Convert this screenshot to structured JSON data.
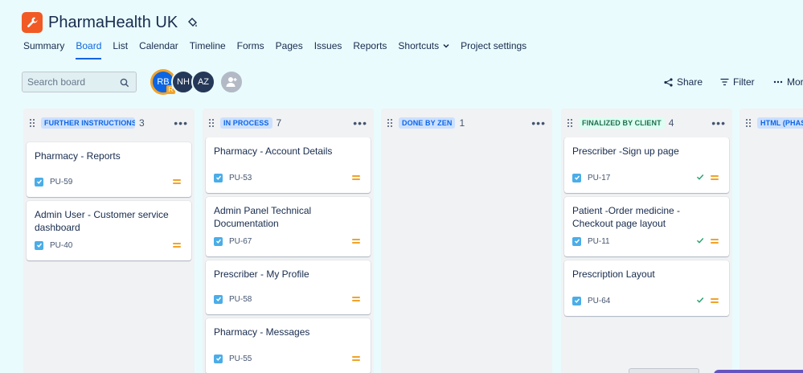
{
  "project": {
    "title": "PharmaHealth UK",
    "logo_icon": "wrench-icon",
    "brand_color": "#f15a24"
  },
  "nav": {
    "tabs": [
      {
        "label": "Summary"
      },
      {
        "label": "Board"
      },
      {
        "label": "List"
      },
      {
        "label": "Calendar"
      },
      {
        "label": "Timeline"
      },
      {
        "label": "Forms"
      },
      {
        "label": "Pages"
      },
      {
        "label": "Issues"
      },
      {
        "label": "Reports"
      },
      {
        "label": "Shortcuts"
      },
      {
        "label": "Project settings"
      }
    ],
    "active": "Board"
  },
  "toolbar": {
    "search_placeholder": "Search board",
    "avatars": [
      {
        "initials": "RB",
        "badge": "R"
      },
      {
        "initials": "NH"
      },
      {
        "initials": "AZ"
      }
    ],
    "share_label": "Share",
    "filter_label": "Filter",
    "more_label": "More"
  },
  "columns": [
    {
      "name": "FURTHER INSTRUCTIONS ...",
      "count": "3",
      "color": "#0c66e4",
      "cards": [
        {
          "title": "Pharmacy - Reports",
          "key": "PU-59",
          "done": false
        },
        {
          "title": "Admin User - Customer service dashboard",
          "key": "PU-40",
          "done": false
        }
      ]
    },
    {
      "name": "IN PROCESS",
      "count": "7",
      "color": "#0c66e4",
      "cards": [
        {
          "title": "Pharmacy - Account Details",
          "key": "PU-53",
          "done": false
        },
        {
          "title": "Admin Panel Technical Documentation",
          "key": "PU-67",
          "done": false
        },
        {
          "title": "Prescriber - My Profile",
          "key": "PU-58",
          "done": false
        },
        {
          "title": "Pharmacy - Messages",
          "key": "PU-55",
          "done": false
        }
      ]
    },
    {
      "name": "DONE BY ZEN",
      "count": "1",
      "color": "#0c66e4",
      "cards": []
    },
    {
      "name": "FINALIZED BY CLIENT",
      "count": "4",
      "color": "#216e4e",
      "cards": [
        {
          "title": "Prescriber -Sign up page",
          "key": "PU-17",
          "done": true
        },
        {
          "title": "Patient -Order medicine - Checkout page layout",
          "key": "PU-11",
          "done": true
        },
        {
          "title": "Prescription Layout",
          "key": "PU-64",
          "done": true
        }
      ]
    },
    {
      "name": "HTML (PHAS",
      "count": "",
      "color": "#0c66e4",
      "cards": []
    }
  ]
}
